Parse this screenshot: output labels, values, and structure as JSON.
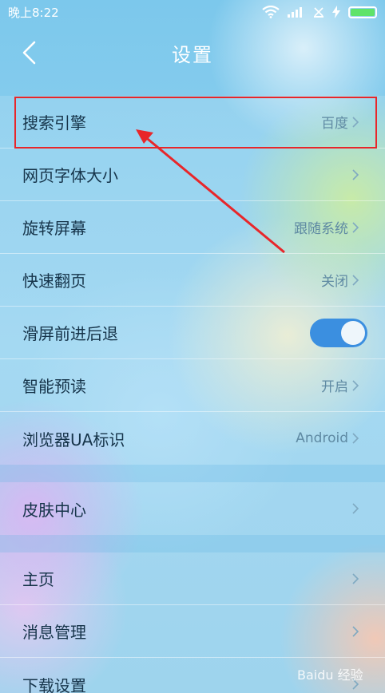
{
  "status_bar": {
    "time": "晚上8:22",
    "icons": [
      "wifi-icon",
      "signal-icon",
      "no-sim-icon",
      "charging-icon",
      "battery-icon"
    ]
  },
  "header": {
    "title": "设置",
    "back_icon": "chevron-left-icon"
  },
  "group1": [
    {
      "label": "搜索引擎",
      "value": "百度"
    },
    {
      "label": "网页字体大小",
      "value": ""
    },
    {
      "label": "旋转屏幕",
      "value": "跟随系统"
    },
    {
      "label": "快速翻页",
      "value": "关闭"
    },
    {
      "label": "滑屏前进后退",
      "toggle": true
    },
    {
      "label": "智能预读",
      "value": "开启"
    },
    {
      "label": "浏览器UA标识",
      "value": "Android"
    }
  ],
  "group2": [
    {
      "label": "皮肤中心",
      "value": ""
    }
  ],
  "group3": [
    {
      "label": "主页",
      "value": ""
    },
    {
      "label": "消息管理",
      "value": ""
    },
    {
      "label": "下载设置",
      "value": ""
    }
  ],
  "colors": {
    "annotation": "#e8262a",
    "toggle_on": "#3b8fe0",
    "accent_text": "#16344a"
  },
  "watermark": "Baidu 经验"
}
